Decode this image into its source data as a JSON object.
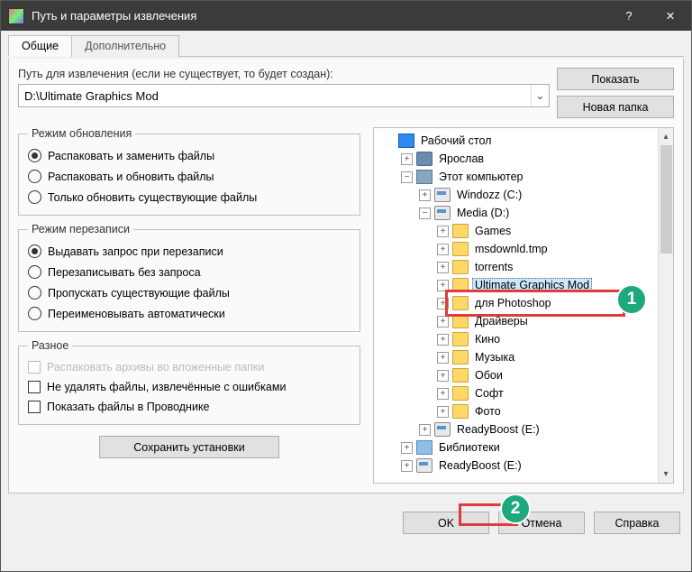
{
  "title": "Путь и параметры извлечения",
  "tabs": {
    "general": "Общие",
    "advanced": "Дополнительно"
  },
  "path": {
    "label": "Путь для извлечения (если не существует, то будет создан):",
    "value": "D:\\Ultimate Graphics Mod"
  },
  "buttons": {
    "show": "Показать",
    "newfolder": "Новая папка",
    "save": "Сохранить установки",
    "ok": "OK",
    "cancel": "Отмена",
    "help": "Справка"
  },
  "groups": {
    "update": {
      "legend": "Режим обновления",
      "opts": [
        "Распаковать и заменить файлы",
        "Распаковать и обновить файлы",
        "Только обновить существующие файлы"
      ]
    },
    "overwrite": {
      "legend": "Режим перезаписи",
      "opts": [
        "Выдавать запрос при перезаписи",
        "Перезаписывать без запроса",
        "Пропускать существующие файлы",
        "Переименовывать автоматически"
      ]
    },
    "misc": {
      "legend": "Разное",
      "opts": [
        "Распаковать архивы во вложенные папки",
        "Не удалять файлы, извлечённые с ошибками",
        "Показать файлы в Проводнике"
      ]
    }
  },
  "tree": [
    {
      "d": 0,
      "exp": "none",
      "ico": "desktop",
      "label": "Рабочий стол"
    },
    {
      "d": 1,
      "exp": "plus",
      "ico": "user",
      "label": "Ярослав"
    },
    {
      "d": 1,
      "exp": "minus",
      "ico": "pc",
      "label": "Этот компьютер"
    },
    {
      "d": 2,
      "exp": "plus",
      "ico": "drive",
      "label": "Windozz (C:)"
    },
    {
      "d": 2,
      "exp": "minus",
      "ico": "drive",
      "label": "Media (D:)"
    },
    {
      "d": 3,
      "exp": "plus",
      "ico": "folder",
      "label": "Games"
    },
    {
      "d": 3,
      "exp": "plus",
      "ico": "folder",
      "label": "msdownld.tmp"
    },
    {
      "d": 3,
      "exp": "plus",
      "ico": "folder",
      "label": "torrents"
    },
    {
      "d": 3,
      "exp": "plus",
      "ico": "folder",
      "label": "Ultimate Graphics Mod",
      "sel": true
    },
    {
      "d": 3,
      "exp": "plus",
      "ico": "folder",
      "label": "для Photoshop"
    },
    {
      "d": 3,
      "exp": "plus",
      "ico": "folder",
      "label": "Драйверы"
    },
    {
      "d": 3,
      "exp": "plus",
      "ico": "folder",
      "label": "Кино"
    },
    {
      "d": 3,
      "exp": "plus",
      "ico": "folder",
      "label": "Музыка"
    },
    {
      "d": 3,
      "exp": "plus",
      "ico": "folder",
      "label": "Обои"
    },
    {
      "d": 3,
      "exp": "plus",
      "ico": "folder",
      "label": "Софт"
    },
    {
      "d": 3,
      "exp": "plus",
      "ico": "folder",
      "label": "Фото"
    },
    {
      "d": 2,
      "exp": "plus",
      "ico": "drive",
      "label": "ReadyBoost (E:)"
    },
    {
      "d": 1,
      "exp": "plus",
      "ico": "lib",
      "label": "Библиотеки"
    },
    {
      "d": 1,
      "exp": "plus",
      "ico": "drive",
      "label": "ReadyBoost (E:)"
    }
  ],
  "annotations": {
    "one": "1",
    "two": "2"
  }
}
